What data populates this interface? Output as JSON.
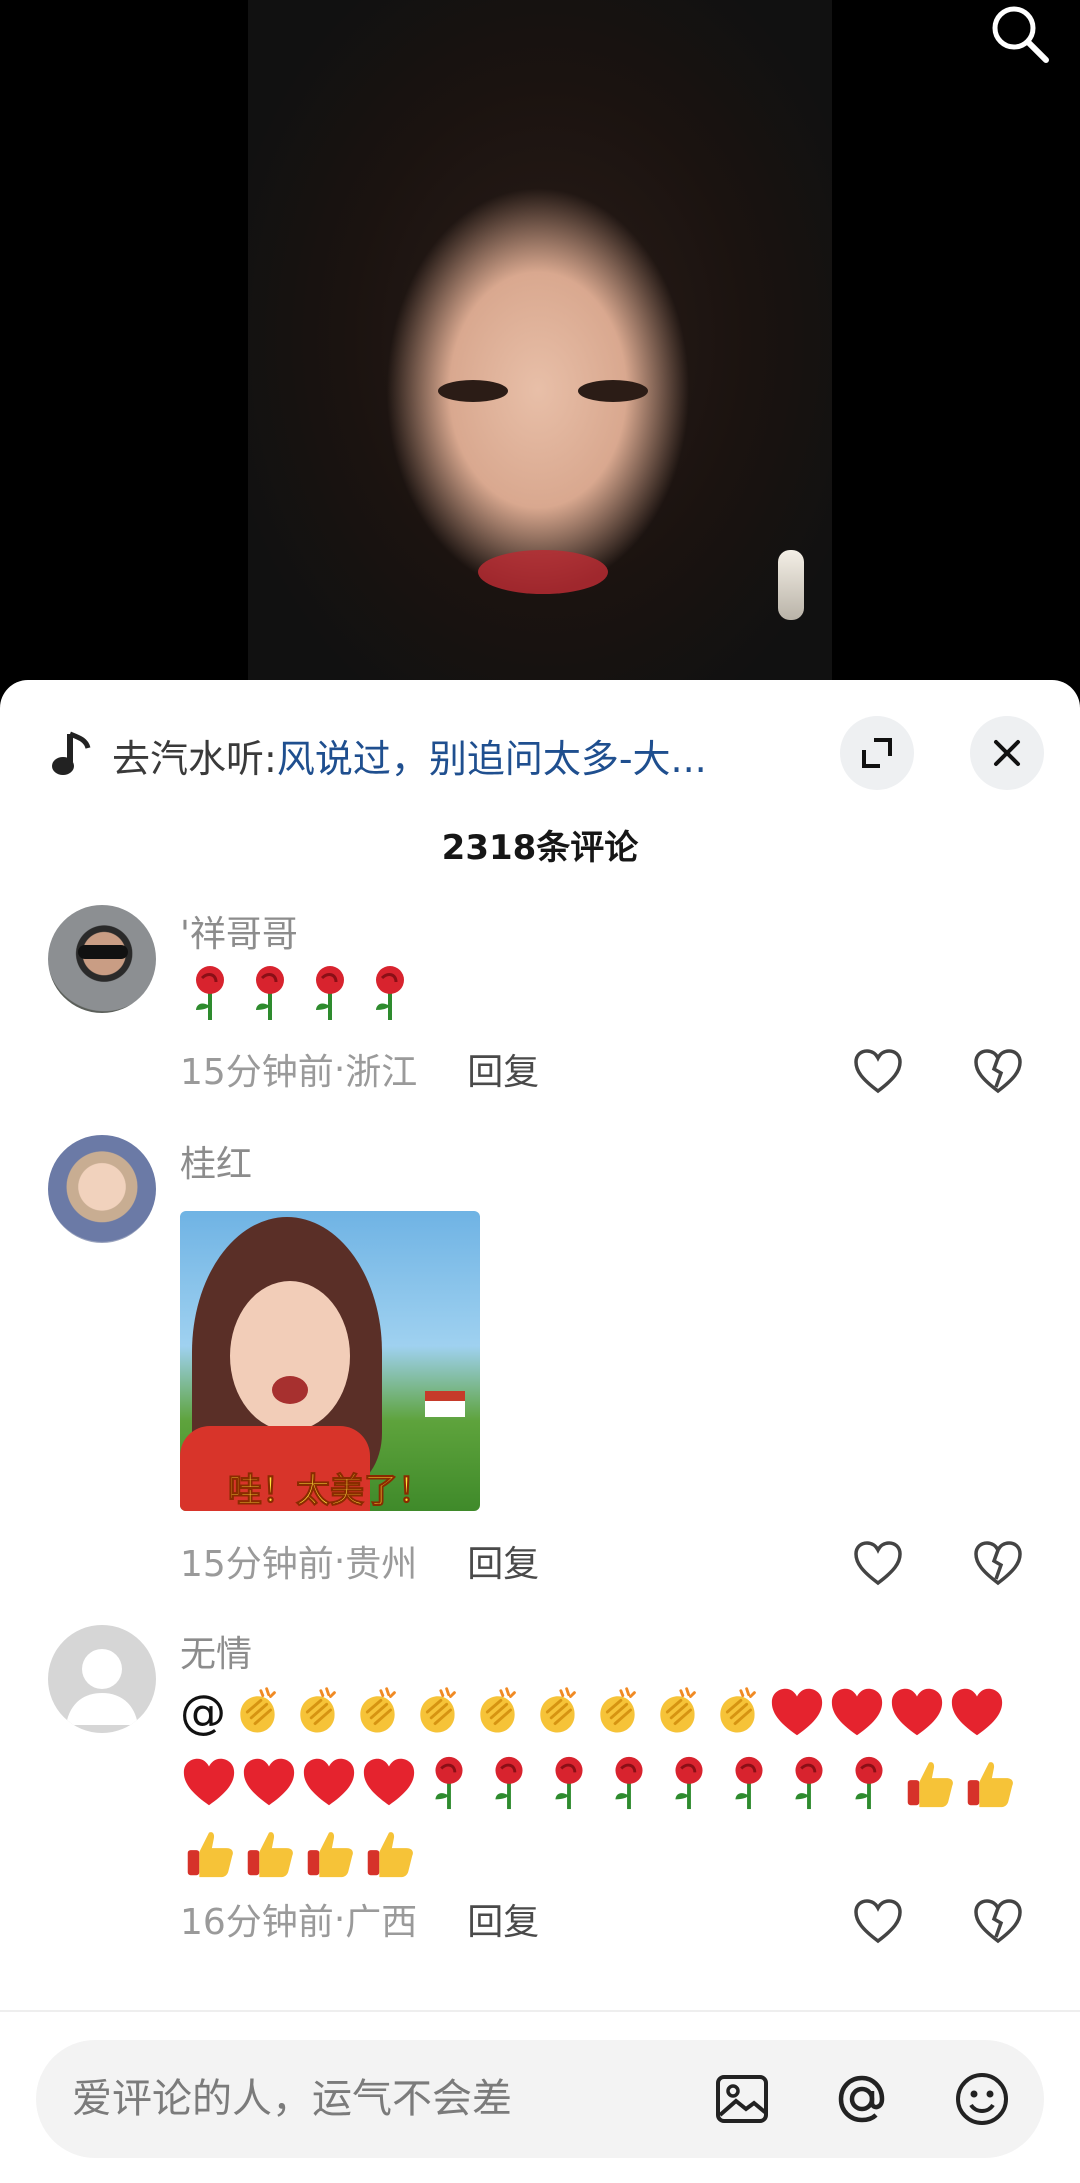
{
  "video": {
    "search_icon": "search-icon"
  },
  "music_bar": {
    "prefix": "去汽水听: ",
    "title": "风说过，别追问太多-大..."
  },
  "comment_count": "2318条评论",
  "comments": [
    {
      "username": "'祥哥哥",
      "text_icons": "rose-emoji x4",
      "time": "15分钟前",
      "location": "浙江",
      "reply_label": "回复"
    },
    {
      "username": "桂红",
      "sticker_caption": "哇！太美了！",
      "time": "15分钟前",
      "location": "贵州",
      "reply_label": "回复"
    },
    {
      "username": "无情",
      "text_prefix": "@",
      "text_icons": "clap-emoji x9, heart-emoji x8, rose-emoji x8, thumbs-up-emoji x6",
      "time": "16分钟前",
      "location": "广西",
      "reply_label": "回复"
    }
  ],
  "meta_separator": " · ",
  "input": {
    "placeholder": "爱评论的人，运气不会差"
  },
  "colors": {
    "music_title": "#1f4f8f",
    "heart": "#e5232e",
    "rose": "#d8232e",
    "sheet": "#ffffff",
    "input_bg": "#f3f3f3"
  }
}
